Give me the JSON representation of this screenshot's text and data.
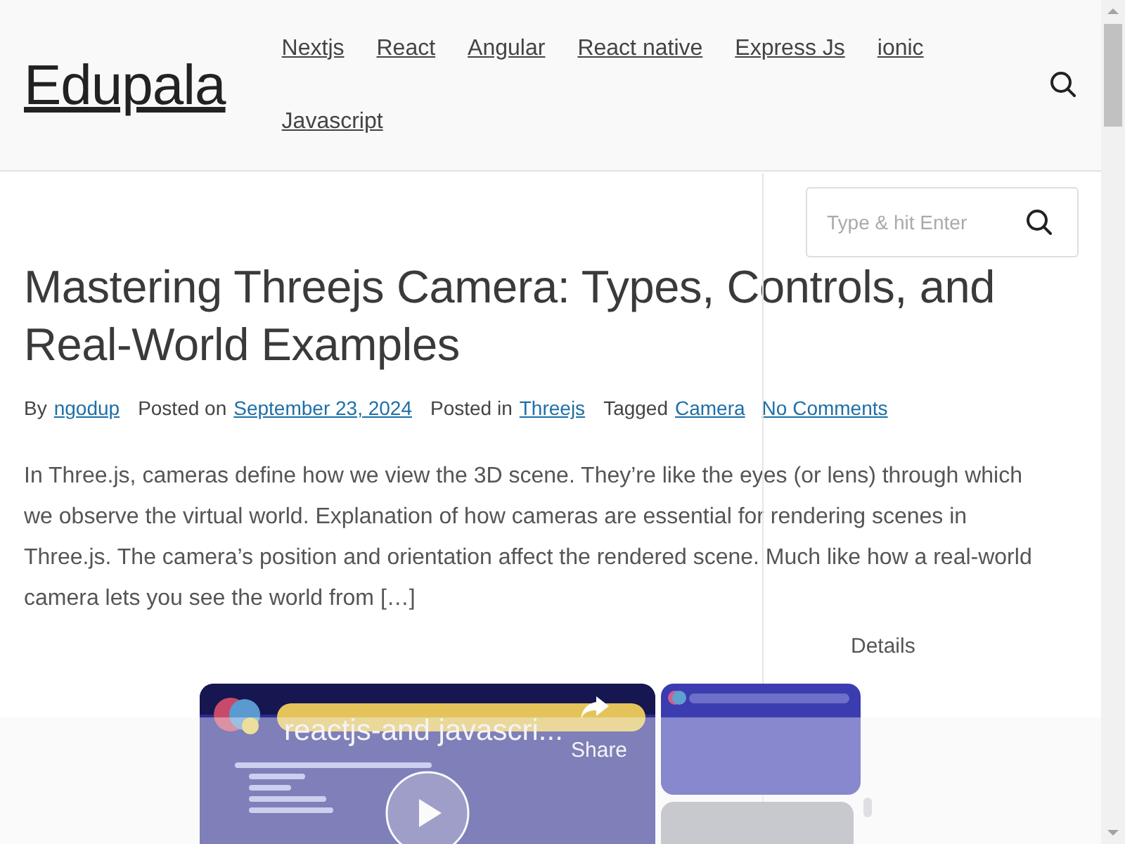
{
  "header": {
    "logo": "Edupala",
    "nav": [
      {
        "label": "Nextjs"
      },
      {
        "label": "React"
      },
      {
        "label": "Angular"
      },
      {
        "label": "React native"
      },
      {
        "label": "Express Js"
      },
      {
        "label": "ionic"
      },
      {
        "label": "Javascript"
      }
    ]
  },
  "post": {
    "title": "Mastering Threejs Camera: Types, Controls, and Real-World Examples",
    "meta": [
      {
        "label": "By",
        "links": [
          "ngodup"
        ]
      },
      {
        "label": "Posted on",
        "links": [
          "September 23, 2024"
        ]
      },
      {
        "label": "Posted in",
        "links": [
          "Threejs"
        ]
      },
      {
        "label": "Tagged",
        "links": [
          "Camera",
          "No Comments"
        ]
      }
    ],
    "excerpt": "In Three.js, cameras define how we view the 3D scene. They’re like the eyes (or lens) through which we observe the virtual world. Explanation of how cameras are essential for rendering scenes in Three.js. The camera’s position and orientation affect the rendered scene. Much like how a real-world camera lets you see the world from […]"
  },
  "sidebar": {
    "search": {
      "placeholder": "Type & hit Enter"
    },
    "details": "Details"
  },
  "video": {
    "title": "reactjs-and javascri...",
    "share": "Share"
  }
}
